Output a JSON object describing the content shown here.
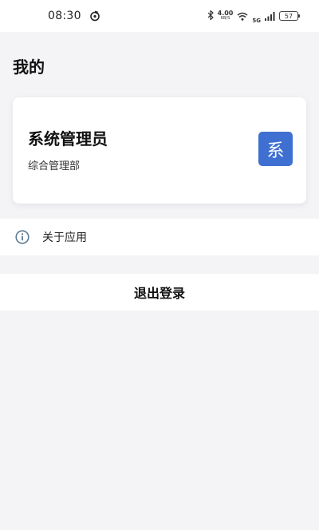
{
  "status_bar": {
    "time": "08:30",
    "app_icon": "refresh-app-icon",
    "bluetooth_icon": "bluetooth-icon",
    "net_speed": "4.00",
    "net_speed_unit": "KB/S",
    "wifi_icon": "wifi-icon",
    "network_type": "5G",
    "signal_icon": "signal-icon",
    "battery": "57"
  },
  "page": {
    "title": "我的"
  },
  "profile": {
    "name": "系统管理员",
    "department": "综合管理部",
    "avatar_char": "系",
    "avatar_color": "#3f6fd1"
  },
  "menu": {
    "about_icon": "info-icon",
    "about_label": "关于应用",
    "logout_label": "退出登录"
  }
}
